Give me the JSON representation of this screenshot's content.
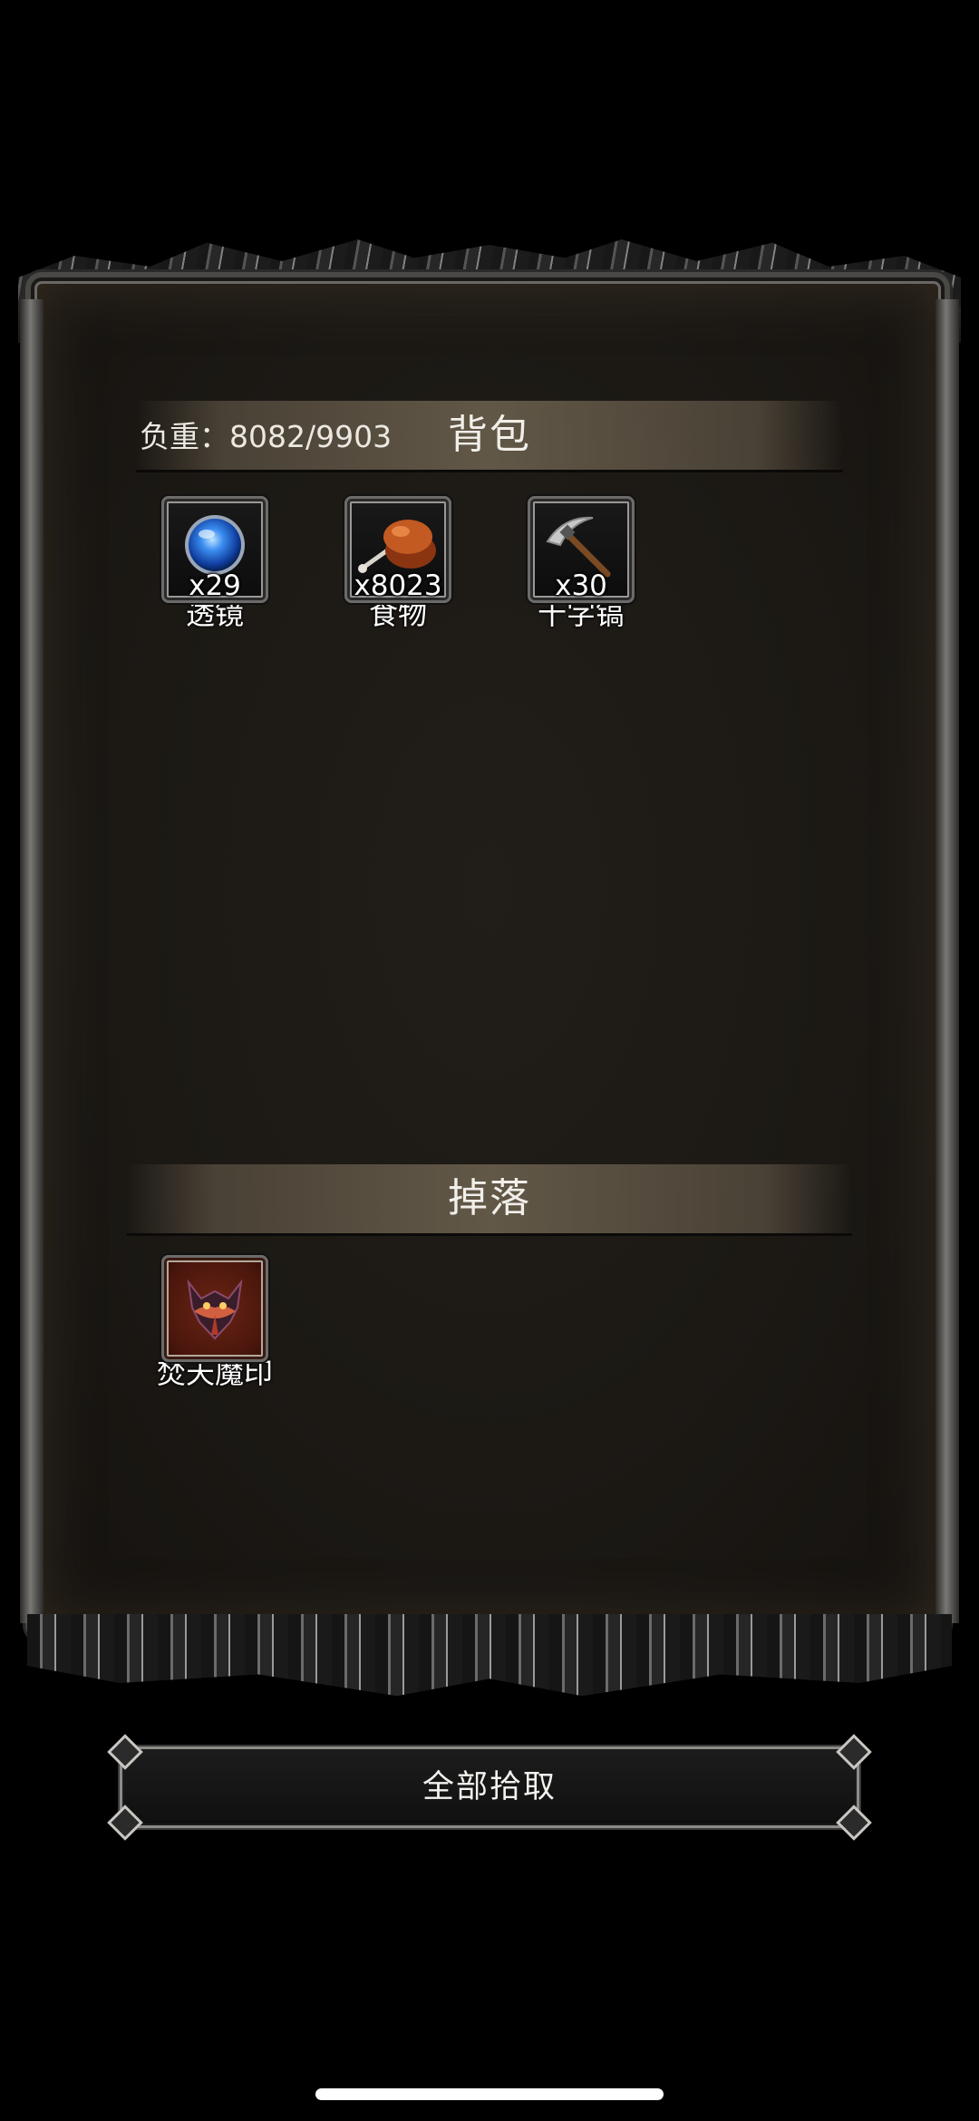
{
  "backpack": {
    "title": "背包",
    "weight_label": "负重：8082/9903",
    "items": [
      {
        "name": "透镜",
        "qty": "x29",
        "icon": "lens-icon"
      },
      {
        "name": "食物",
        "qty": "x8023",
        "icon": "food-icon"
      },
      {
        "name": "十字镐",
        "qty": "x30",
        "icon": "pickaxe-icon"
      }
    ]
  },
  "drops": {
    "title": "掉落",
    "items": [
      {
        "name": "焚天魔印",
        "icon": "demon-seal-icon"
      }
    ]
  },
  "actions": {
    "pickup_all_label": "全部拾取"
  },
  "colors": {
    "background": "#000000",
    "panel": "#1c1915",
    "header_band": "#786c58",
    "text": "#f1efe9"
  }
}
